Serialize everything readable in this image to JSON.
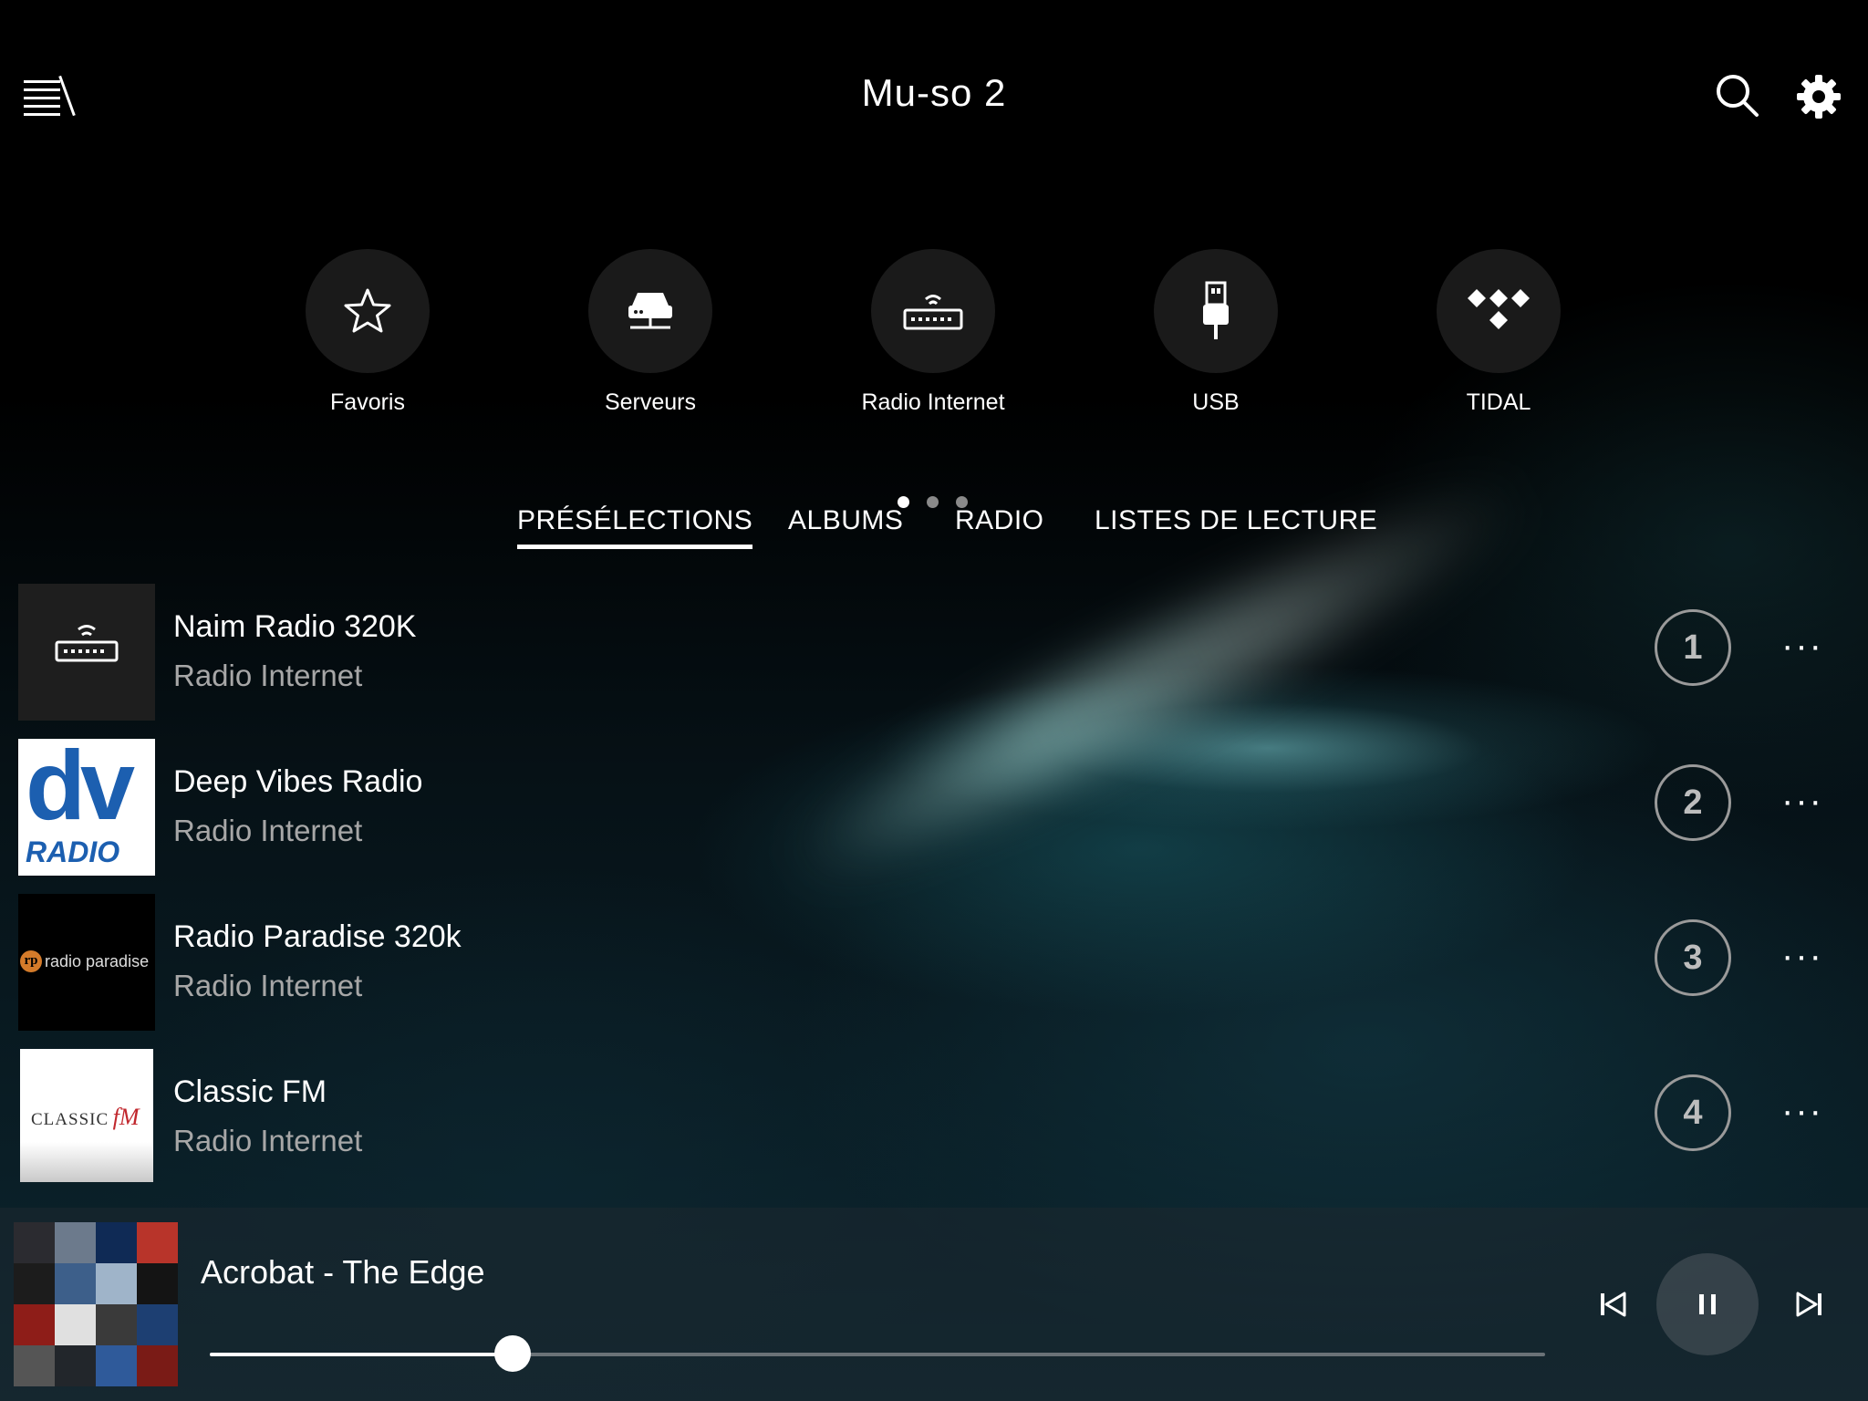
{
  "header": {
    "title": "Mu-so  2",
    "menu_icon": "menu-icon",
    "search_icon": "search-icon",
    "settings_icon": "gear-icon"
  },
  "sources": [
    {
      "label": "Favoris",
      "icon": "star-icon"
    },
    {
      "label": "Serveurs",
      "icon": "server-icon"
    },
    {
      "label": "Radio Internet",
      "icon": "radio-icon"
    },
    {
      "label": "USB",
      "icon": "usb-icon"
    },
    {
      "label": "TIDAL",
      "icon": "tidal-icon"
    }
  ],
  "page_dots": {
    "count": 3,
    "active": 1
  },
  "tabs": [
    {
      "label": "PRÉSÉLECTIONS",
      "active": true
    },
    {
      "label": "ALBUMS",
      "active": false
    },
    {
      "label": "RADIO",
      "active": false
    },
    {
      "label": "LISTES DE LECTURE",
      "active": false
    }
  ],
  "presets": [
    {
      "title": "Naim Radio 320K",
      "subtitle": "Radio Internet",
      "number": "1",
      "more": "···"
    },
    {
      "title": "Deep Vibes Radio",
      "subtitle": "Radio Internet",
      "number": "2",
      "more": "···",
      "logo_text": {
        "big": "dv",
        "small": "RADIO"
      }
    },
    {
      "title": "Radio Paradise 320k",
      "subtitle": "Radio Internet",
      "number": "3",
      "more": "···",
      "logo_text": {
        "mark": "rp",
        "name": "radio paradise"
      }
    },
    {
      "title": "Classic FM",
      "subtitle": "Radio Internet",
      "number": "4",
      "more": "···",
      "logo_text": {
        "a": "CLASSIC",
        "b": "fM"
      }
    }
  ],
  "now_playing": {
    "track": "Acrobat - The Edge",
    "progress_fraction": 0.227,
    "controls": {
      "previous": "previous-icon",
      "pause": "pause-icon",
      "next": "next-icon"
    }
  },
  "colors": {
    "background": "#000000",
    "accent": "#ffffff",
    "muted_text": "#a7a7a7",
    "deep_vibes_blue": "#1c5fb0"
  }
}
